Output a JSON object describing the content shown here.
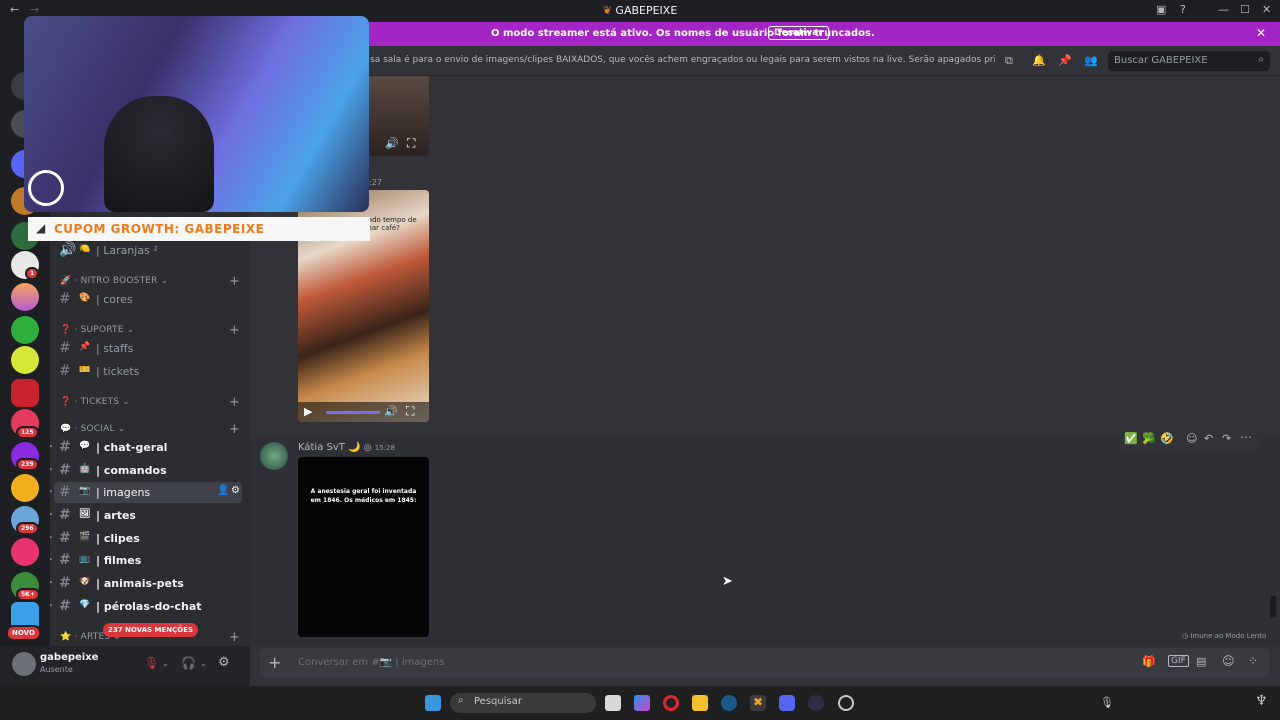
{
  "window": {
    "title": "GABEPEIXE"
  },
  "banner": {
    "text": "O modo streamer está ativo. Os nomes de usuário foram truncados.",
    "button": "Desativar"
  },
  "topic": {
    "text": "sa sala é para o envio de imagens/clipes BAIXADOS, que vocês achem engraçados ou legais para serem vistos na live. Serão apagados prints de outras rede...",
    "search_placeholder": "Buscar GABEPEIXE"
  },
  "overlay": {
    "promo": "CUPOM GROWTH: GABEPEIXE"
  },
  "guild_badges": [
    "1",
    "125",
    "239",
    "296",
    "5K+",
    "NOVO"
  ],
  "sidebar": {
    "first_channel": {
      "emoji": "🍋",
      "name": "| Laranjas ²"
    },
    "categories": [
      {
        "label": "NITRO BOOSTER",
        "channels": [
          {
            "emoji": "🎨",
            "name": "| cores"
          }
        ]
      },
      {
        "label": "SUPORTE",
        "channels": [
          {
            "emoji": "📌",
            "name": "| staffs"
          },
          {
            "emoji": "🎫",
            "name": "| tickets"
          }
        ]
      },
      {
        "label": "TICKETS",
        "channels": []
      },
      {
        "label": "SOCIAL",
        "channels": [
          {
            "emoji": "💬",
            "name": "| chat-geral"
          },
          {
            "emoji": "🤖",
            "name": "| comandos"
          },
          {
            "emoji": "📷",
            "name": "| imagens"
          },
          {
            "emoji": "🖼",
            "name": "| artes"
          },
          {
            "emoji": "🎬",
            "name": "| clipes"
          },
          {
            "emoji": "📺",
            "name": "| filmes"
          },
          {
            "emoji": "🐶",
            "name": "| animais-pets"
          },
          {
            "emoji": "💎",
            "name": "| pérolas-do-chat"
          }
        ]
      },
      {
        "label": "ARTES",
        "channels": []
      }
    ],
    "mentions_pill": "237 NOVAS MENÇÕES"
  },
  "user": {
    "name": "gabepeixe",
    "status": "Ausente"
  },
  "messages": {
    "timestamp_partial": ":27",
    "image_text": "Dando tempo de tomar café?",
    "author": "Kátia SvT",
    "author_emoji": "🌙",
    "time": "15:28",
    "meme_text": "A anestesia geral foi inventada em 1846. Os médicos em 1845:",
    "reactions": [
      "✅",
      "🥦",
      "🤣"
    ]
  },
  "footer": {
    "slowmode": "Imune ao Modo Lento",
    "composer_placeholder": "Conversar em #📷 | imagens"
  },
  "taskbar": {
    "search": "Pesquisar"
  },
  "colors": {
    "accent": "#a326c4",
    "bg": "#313338",
    "sidebar": "#2b2d31",
    "mention": "#da373c"
  }
}
